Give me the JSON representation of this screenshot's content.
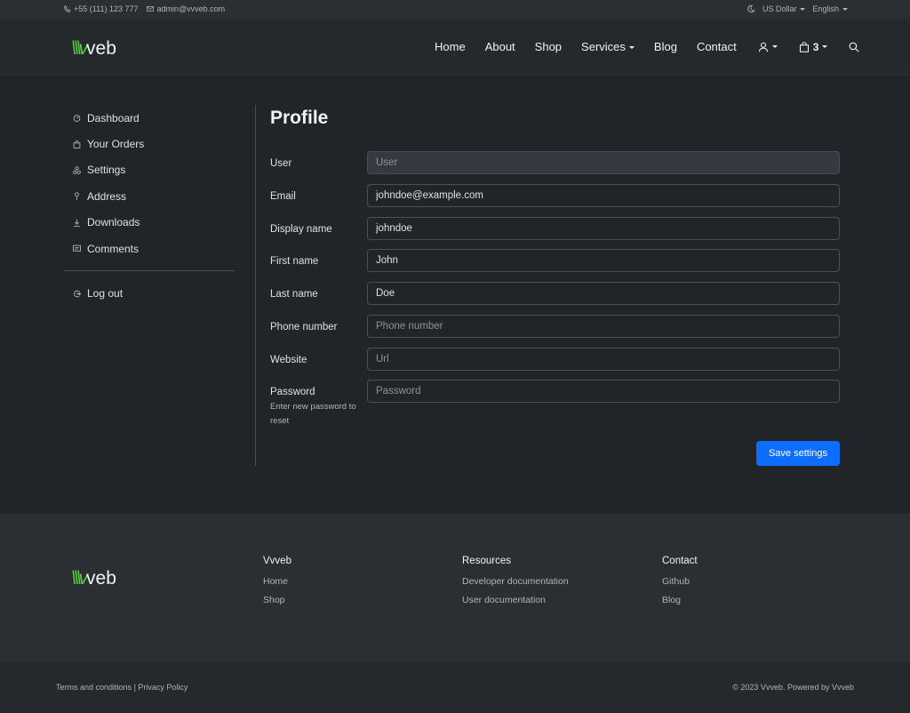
{
  "topbar": {
    "phone": "+55 (111) 123 777",
    "email": "admin@vvveb.com",
    "currency": "US Dollar",
    "language": "English"
  },
  "brand": {
    "slashes": "\\\\\\v",
    "word": "veb"
  },
  "nav": {
    "items": [
      "Home",
      "About",
      "Shop",
      "Services",
      "Blog",
      "Contact"
    ],
    "cart_count": "3"
  },
  "sidebar": {
    "items": [
      {
        "label": "Dashboard",
        "icon": "dashboard-icon"
      },
      {
        "label": "Your Orders",
        "icon": "bag-icon"
      },
      {
        "label": "Settings",
        "icon": "settings-icon"
      },
      {
        "label": "Address",
        "icon": "pin-icon"
      },
      {
        "label": "Downloads",
        "icon": "download-icon"
      },
      {
        "label": "Comments",
        "icon": "comment-icon"
      }
    ],
    "logout": "Log out"
  },
  "profile": {
    "title": "Profile",
    "fields": [
      {
        "label": "User",
        "value": "",
        "placeholder": "User",
        "disabled": true
      },
      {
        "label": "Email",
        "value": "johndoe@example.com",
        "placeholder": ""
      },
      {
        "label": "Display name",
        "value": "johndoe",
        "placeholder": ""
      },
      {
        "label": "First name",
        "value": "John",
        "placeholder": ""
      },
      {
        "label": "Last name",
        "value": "Doe",
        "placeholder": ""
      },
      {
        "label": "Phone number",
        "value": "",
        "placeholder": "Phone number"
      },
      {
        "label": "Website",
        "value": "",
        "placeholder": "Url"
      },
      {
        "label": "Password",
        "value": "",
        "placeholder": "Password",
        "help": "Enter new password to reset"
      }
    ],
    "save_label": "Save settings"
  },
  "footer": {
    "cols": [
      {
        "heading": "Vvveb",
        "links": [
          "Home",
          "Shop"
        ]
      },
      {
        "heading": "Resources",
        "links": [
          "Developer documentation",
          "User documentation"
        ]
      },
      {
        "heading": "Contact",
        "links": [
          "Github",
          "Blog"
        ]
      }
    ],
    "terms": "Terms and conditions",
    "privacy": "Privacy Policy",
    "separator": "|",
    "copyright": "© 2023 Vvveb. Powered by Vvveb"
  },
  "colors": {
    "accent": "#0d6efd",
    "brand": "#5ad13a",
    "background": "#212428"
  }
}
